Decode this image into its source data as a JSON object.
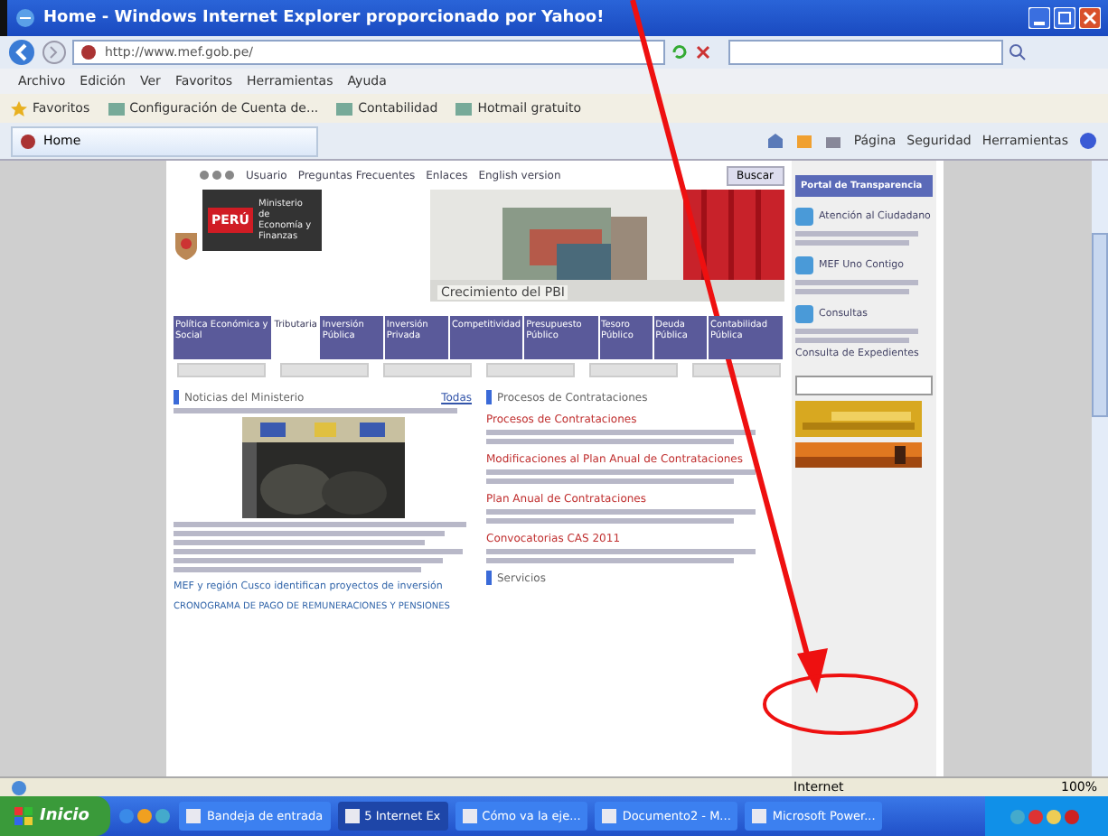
{
  "window": {
    "title": "Home - Windows Internet Explorer proporcionado por Yahoo!"
  },
  "address": {
    "value": "http://www.mef.gob.pe/"
  },
  "menu": [
    "Archivo",
    "Edición",
    "Ver",
    "Favoritos",
    "Herramientas",
    "Ayuda"
  ],
  "favorites": [
    {
      "label": "Favoritos"
    },
    {
      "label": "Configuración de Cuenta de..."
    },
    {
      "label": "Contabilidad"
    },
    {
      "label": "Hotmail gratuito"
    }
  ],
  "tab": {
    "label": "Home"
  },
  "commands": [
    "Página",
    "Seguridad",
    "Herramientas"
  ],
  "page": {
    "top_links": [
      "Usuario",
      "Preguntas Frecuentes",
      "Enlaces",
      "English version"
    ],
    "search_button": "Buscar",
    "logo": {
      "badge": "PERÚ",
      "name": "Ministerio de Economía y Finanzas"
    },
    "banner_caption": "Crecimiento del PBI",
    "nav": [
      {
        "label": "Política Económica y Social",
        "selected": false
      },
      {
        "label": "Tributaria",
        "selected": true
      },
      {
        "label": "Inversión Pública",
        "selected": false
      },
      {
        "label": "Inversión Privada",
        "selected": false
      },
      {
        "label": "Competitividad",
        "selected": false
      },
      {
        "label": "Presupuesto Público",
        "selected": false
      },
      {
        "label": "Tesoro Público",
        "selected": false
      },
      {
        "label": "Deuda Pública",
        "selected": false
      },
      {
        "label": "Contabilidad Pública",
        "selected": false
      }
    ],
    "news": {
      "heading": "Noticias del Ministerio",
      "more": "Todas",
      "items": [
        "MEF y región Cusco identifican proyectos de inversión",
        "CRONOGRAMA DE PAGO DE REMUNERACIONES Y PENSIONES"
      ]
    },
    "procesos": {
      "heading": "Procesos de Contrataciones",
      "items": [
        "Procesos de Contrataciones",
        "Modificaciones al Plan Anual de Contrataciones",
        "Plan Anual de Contrataciones",
        "Convocatorias CAS 2011"
      ]
    },
    "servicios": {
      "heading": "Servicios"
    }
  },
  "sidebar": {
    "portal": "Portal de Transparencia",
    "items": [
      "Atención al Ciudadano",
      "MEF Uno Contigo",
      "Consultas"
    ],
    "expedientes": "Consulta de Expedientes"
  },
  "status_bar": {
    "zone": "Internet",
    "zoom": "100%"
  },
  "taskbar": {
    "start": "Inicio",
    "buttons": [
      {
        "label": "Bandeja de entrada",
        "selected": false
      },
      {
        "label": "5 Internet Ex",
        "selected": true
      },
      {
        "label": "Cómo va la eje...",
        "selected": false
      },
      {
        "label": "Documento2 - M...",
        "selected": false
      },
      {
        "label": "Microsoft Power...",
        "selected": false
      }
    ]
  }
}
